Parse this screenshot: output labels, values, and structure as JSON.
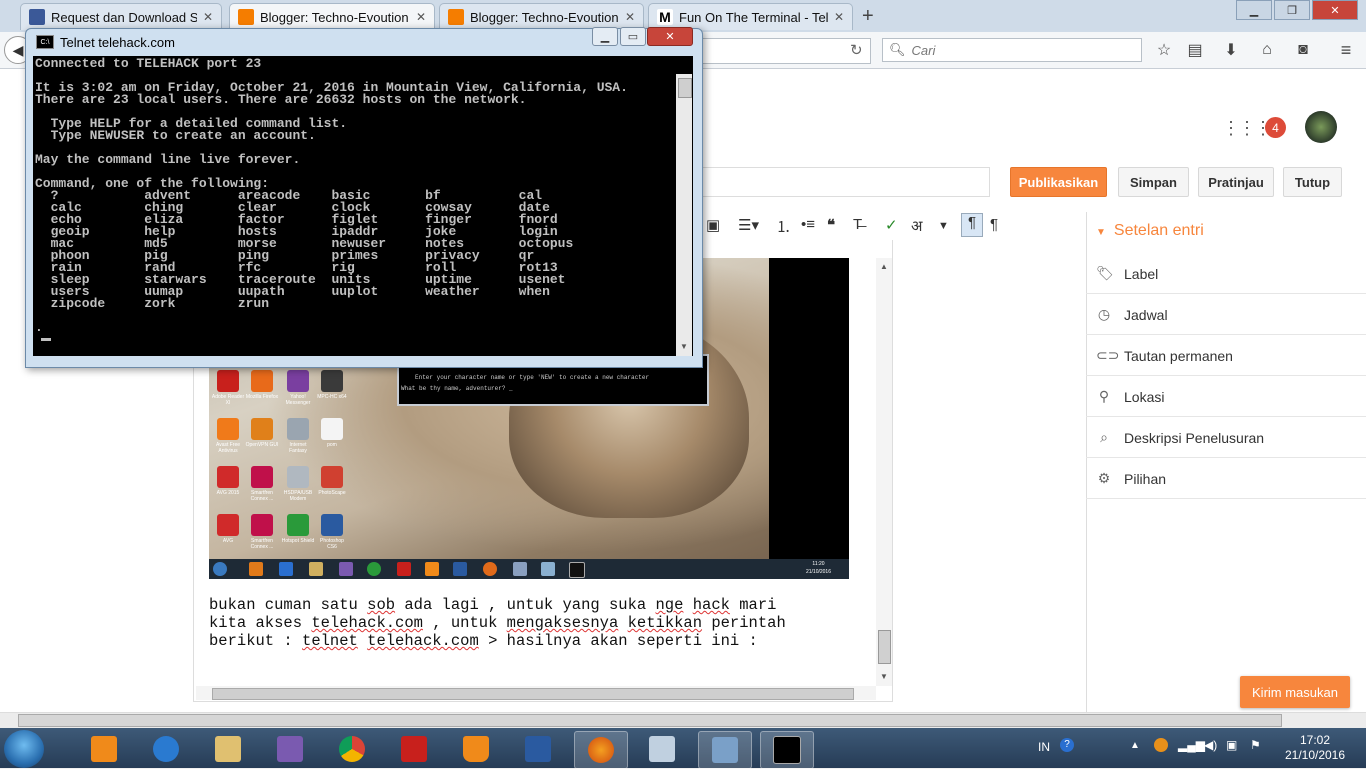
{
  "browser": {
    "tabs": [
      {
        "title": "Request dan Download Sof...",
        "favicon_color": "#3b5998"
      },
      {
        "title": "Blogger: Techno-Evoution ...",
        "favicon_color": "#f57d00"
      },
      {
        "title": "Blogger: Techno-Evoution ...",
        "favicon_color": "#f57d00"
      },
      {
        "title": "Fun On The Terminal - Tel...",
        "favicon_color": "#222222"
      }
    ],
    "new_tab_label": "+",
    "search_placeholder": "Cari"
  },
  "blogger": {
    "notification_count": "4",
    "buttons": {
      "publish": "Publikasikan",
      "save": "Simpan",
      "preview": "Pratinjau",
      "close": "Tutup"
    },
    "settings_title": "Setelan entri",
    "settings_items": [
      "Label",
      "Jadwal",
      "Tautan permanen",
      "Lokasi",
      "Deskripsi Penelusuran",
      "Pilihan"
    ],
    "feedback_button": "Kirim masukan",
    "toolbar_lang_char": "अ"
  },
  "post": {
    "line1_parts": [
      "bukan cuman satu ",
      "sob",
      " ada lagi , untuk yang suka ",
      "nge",
      " ",
      "hack",
      " mari"
    ],
    "line2_parts": [
      "kita akses ",
      "telehack.com",
      " , untuk ",
      "mengaksesnya",
      " ",
      "ketikkan",
      " perintah"
    ],
    "line3_parts": [
      "berikut : ",
      "telnet",
      " ",
      "telehack.com",
      " > hasilnya akan seperti ini :"
    ],
    "embedded_screenshot": {
      "desktop_icons": [
        "Adobe Reader XI",
        "Mozilla Firefox",
        "Yahoo! Messenger",
        "MPC-HC x64",
        "Avast Free Antivirus",
        "OpenVPN GUI",
        "Internet Fantasy",
        "pom",
        "AVG 2015",
        "Smartfren Connex ...",
        "HSDPA/USB Modem",
        "PhotoScape",
        "AVG",
        "Smartfren Connex ...",
        "Hotspot Shield",
        "Photoshop CS6"
      ],
      "inner_console_line1": "Enter your character name or type 'NEW' to create a new character",
      "inner_console_line2": "What be thy name, adventurer? _",
      "clock_time": "11:20",
      "clock_date": "21/10/2016"
    }
  },
  "telnet": {
    "window_title": "Telnet telehack.com",
    "console_text": "Connected to TELEHACK port 23\n\nIt is 3:02 am on Friday, October 21, 2016 in Mountain View, California, USA.\nThere are 23 local users. There are 26632 hosts on the network.\n\n  Type HELP for a detailed command list.\n  Type NEWUSER to create an account.\n\nMay the command line live forever.\n\nCommand, one of the following:\n  ?           advent      areacode    basic       bf          cal\n  calc        ching       clear       clock       cowsay      date\n  echo        eliza       factor      figlet      finger      fnord\n  geoip       help        hosts       ipaddr      joke        login\n  mac         md5         morse       newuser     notes       octopus\n  phoon       pig         ping        primes      privacy     qr\n  rain        rand        rfc         rig         roll        rot13\n  sleep       starwars    traceroute  units       uptime      usenet\n  users       uumap       uupath      uuplot      weather     when\n  zipcode     zork        zrun\n\n.",
    "cursor": "_"
  },
  "windows": {
    "tray_lang": "IN",
    "clock_time": "17:02",
    "clock_date": "21/10/2016"
  }
}
